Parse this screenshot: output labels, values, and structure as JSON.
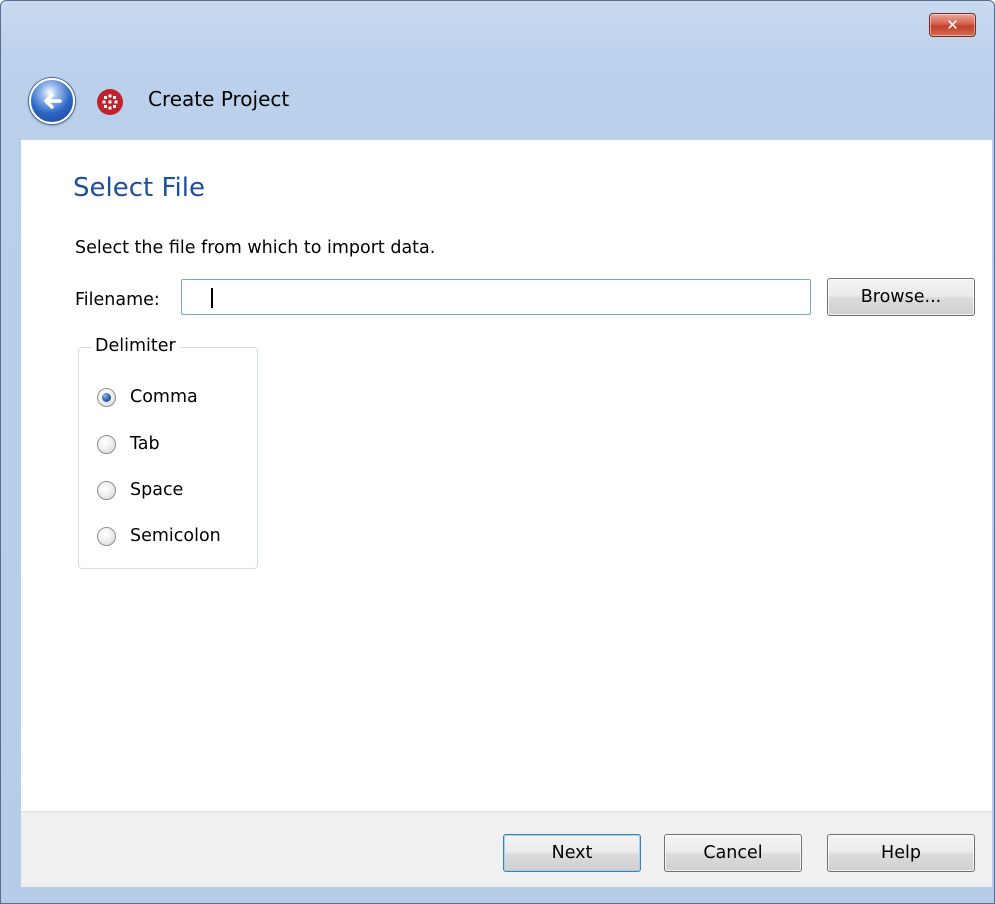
{
  "window": {
    "title": "Create Project",
    "close_label": "✕"
  },
  "page": {
    "heading": "Select File",
    "instruction": "Select the file from which to import data."
  },
  "filename": {
    "label": "Filename:",
    "value": "",
    "browse_label": "Browse..."
  },
  "delimiter": {
    "legend": "Delimiter",
    "options": [
      {
        "label": "Comma",
        "checked": true
      },
      {
        "label": "Tab",
        "checked": false
      },
      {
        "label": "Space",
        "checked": false
      },
      {
        "label": "Semicolon",
        "checked": false
      }
    ]
  },
  "footer": {
    "next_label": "Next",
    "cancel_label": "Cancel",
    "help_label": "Help"
  },
  "icons": {
    "back": "back-arrow-icon",
    "app": "app-grid-icon",
    "close": "close-icon"
  },
  "colors": {
    "heading": "#1e4e9e",
    "frame": "#b9cfea",
    "close_button": "#c2412c"
  }
}
